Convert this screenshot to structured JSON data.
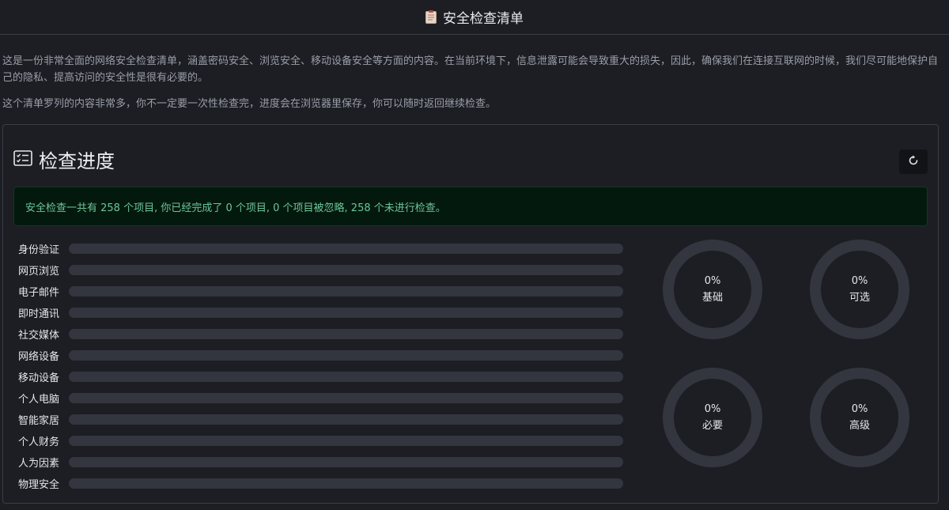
{
  "header": {
    "title": "安全检查清单",
    "icon": "clipboard-icon"
  },
  "intro": {
    "paragraph1": "这是一份非常全面的网络安全检查清单，涵盖密码安全、浏览安全、移动设备安全等方面的内容。在当前环境下，信息泄露可能会导致重大的损失，因此，确保我们在连接互联网的时候，我们尽可能地保护自己的隐私、提高访问的安全性是很有必要的。",
    "paragraph2": "这个清单罗列的内容非常多，你不一定要一次性检查完，进度会在浏览器里保存，你可以随时返回继续检查。"
  },
  "progress_card": {
    "title": "检查进度",
    "title_icon": "checklist-icon",
    "reset_icon": "refresh-icon",
    "summary": "安全检查一共有 258 个项目, 你已经完成了 0 个项目, 0 个项目被忽略, 258 个未进行检查。",
    "categories": [
      {
        "label": "身份验证",
        "progress": 0
      },
      {
        "label": "网页浏览",
        "progress": 0
      },
      {
        "label": "电子邮件",
        "progress": 0
      },
      {
        "label": "即时通讯",
        "progress": 0
      },
      {
        "label": "社交媒体",
        "progress": 0
      },
      {
        "label": "网络设备",
        "progress": 0
      },
      {
        "label": "移动设备",
        "progress": 0
      },
      {
        "label": "个人电脑",
        "progress": 0
      },
      {
        "label": "智能家居",
        "progress": 0
      },
      {
        "label": "个人财务",
        "progress": 0
      },
      {
        "label": "人为因素",
        "progress": 0
      },
      {
        "label": "物理安全",
        "progress": 0
      }
    ],
    "levels": [
      {
        "percent": "0%",
        "label": "基础",
        "value": 0
      },
      {
        "percent": "0%",
        "label": "可选",
        "value": 0
      },
      {
        "percent": "0%",
        "label": "必要",
        "value": 0
      },
      {
        "percent": "0%",
        "label": "高级",
        "value": 0
      }
    ]
  },
  "colors": {
    "background": "#1c1e24",
    "track": "#33363f",
    "accent": "#6cc59a",
    "summary_bg": "#04190d"
  }
}
